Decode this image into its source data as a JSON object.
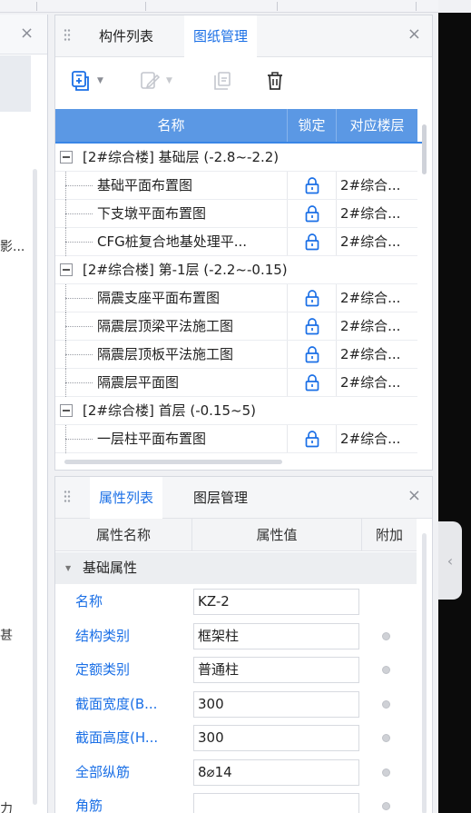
{
  "left_panel": {
    "close": "×",
    "texts": [
      "影...",
      "甚",
      "力"
    ]
  },
  "drawing_panel": {
    "tabs": [
      "构件列表",
      "图纸管理"
    ],
    "active_tab": "图纸管理",
    "close": "×",
    "toolbar": {
      "add_drawing": "add-drawing-icon",
      "edit_drawing": "edit-drawing-icon",
      "split_drawing": "split-drawing-icon",
      "delete": "delete-icon"
    },
    "columns": [
      "名称",
      "锁定",
      "对应楼层"
    ],
    "groups": [
      {
        "label": "[2#综合楼] 基础层 (-2.8~-2.2)",
        "items": [
          {
            "name": "基础平面布置图",
            "floor": "2#综合..."
          },
          {
            "name": "下支墩平面布置图",
            "floor": "2#综合..."
          },
          {
            "name": "CFG桩复合地基处理平...",
            "floor": "2#综合..."
          }
        ]
      },
      {
        "label": "[2#综合楼] 第-1层 (-2.2~-0.15)",
        "items": [
          {
            "name": "隔震支座平面布置图",
            "floor": "2#综合..."
          },
          {
            "name": "隔震层顶梁平法施工图",
            "floor": "2#综合..."
          },
          {
            "name": "隔震层顶板平法施工图",
            "floor": "2#综合..."
          },
          {
            "name": "隔震层平面图",
            "floor": "2#综合..."
          }
        ]
      },
      {
        "label": "[2#综合楼] 首层 (-0.15~5)",
        "items": [
          {
            "name": "一层柱平面布置图",
            "floor": "2#综合..."
          }
        ]
      }
    ]
  },
  "property_panel": {
    "tabs": [
      "属性列表",
      "图层管理"
    ],
    "active_tab": "属性列表",
    "close": "×",
    "columns": [
      "属性名称",
      "属性值",
      "附加"
    ],
    "group": "基础属性",
    "rows": [
      {
        "name": "名称",
        "value": "KZ-2",
        "has_extra": false
      },
      {
        "name": "结构类别",
        "value": "框架柱",
        "has_extra": true
      },
      {
        "name": "定额类别",
        "value": "普通柱",
        "has_extra": true
      },
      {
        "name": "截面宽度(B...",
        "value": "300",
        "has_extra": true
      },
      {
        "name": "截面高度(H...",
        "value": "300",
        "has_extra": true
      },
      {
        "name": "全部纵筋",
        "value": "8⌀14",
        "has_extra": true
      },
      {
        "name": "角筋",
        "value": "",
        "has_extra": true
      }
    ]
  },
  "colors": {
    "accent": "#1a6fe6",
    "header_blue": "#5b98e4",
    "toolbar_icon": "#1a6fe6"
  },
  "side_handle": "‹"
}
